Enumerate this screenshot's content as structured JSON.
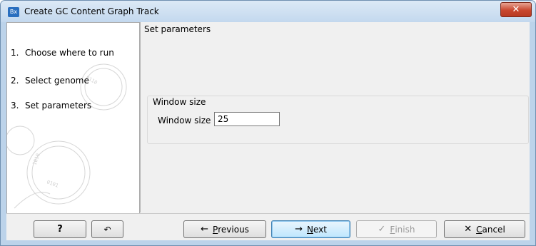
{
  "window": {
    "title": "Create GC Content Graph Track",
    "app_icon": "Bx",
    "close_glyph": "✕"
  },
  "steps": [
    {
      "num": "1.",
      "label": "Choose where to run"
    },
    {
      "num": "2.",
      "label": "Select genome"
    },
    {
      "num": "3.",
      "label": "Set parameters"
    }
  ],
  "main": {
    "section_title": "Set parameters",
    "group_title": "Window size",
    "field_label": "Window size",
    "field_value": "25"
  },
  "buttons": {
    "help": "?",
    "reset_icon": "↶",
    "previous_first": "P",
    "previous_rest": "revious",
    "previous_icon": "←",
    "next_first": "N",
    "next_rest": "ext",
    "next_icon": "→",
    "finish_first": "F",
    "finish_rest": "inish",
    "finish_icon": "✓",
    "cancel_first": "C",
    "cancel_rest": "ancel",
    "cancel_icon": "✕"
  }
}
